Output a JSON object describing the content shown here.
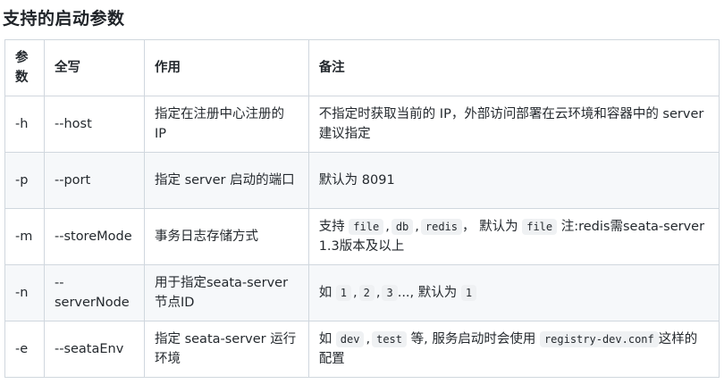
{
  "section_title": "支持的启动参数",
  "headers": {
    "param_line1": "参",
    "param_line2": "数",
    "full": "全写",
    "usage": "作用",
    "note": "备注"
  },
  "rows": [
    {
      "param": "-h",
      "full": "--host",
      "usage": "指定在注册中心注册的 IP",
      "note_text": "不指定时获取当前的 IP，外部访问部署在云环境和容器中的 server 建议指定"
    },
    {
      "param": "-p",
      "full": "--port",
      "usage": "指定 server 启动的端口",
      "note_text": "默认为 8091"
    },
    {
      "param": "-m",
      "full": "--storeMode",
      "usage": "事务日志存储方式",
      "note_prefix": "支持",
      "note_code1": "file",
      "note_code2": "db",
      "note_code3": "redis",
      "note_mid": "， 默认为",
      "note_code4": "file",
      "note_suffix": " 注:redis需seata-server 1.3版本及以上"
    },
    {
      "param": "-n",
      "full": "--serverNode",
      "usage": "用于指定seata-server节点ID",
      "note_prefix": "如",
      "note_code1": "1",
      "note_code2": "2",
      "note_code3": "3",
      "note_mid": "..., 默认为",
      "note_code4": "1"
    },
    {
      "param": "-e",
      "full": "--seataEnv",
      "usage": "指定 seata-server 运行环境",
      "note_prefix": "如",
      "note_code1": "dev",
      "note_code2": "test",
      "note_mid": " 等, 服务启动时会使用",
      "note_code3": "registry-dev.conf",
      "note_suffix": "这样的配置"
    }
  ],
  "separator": ","
}
